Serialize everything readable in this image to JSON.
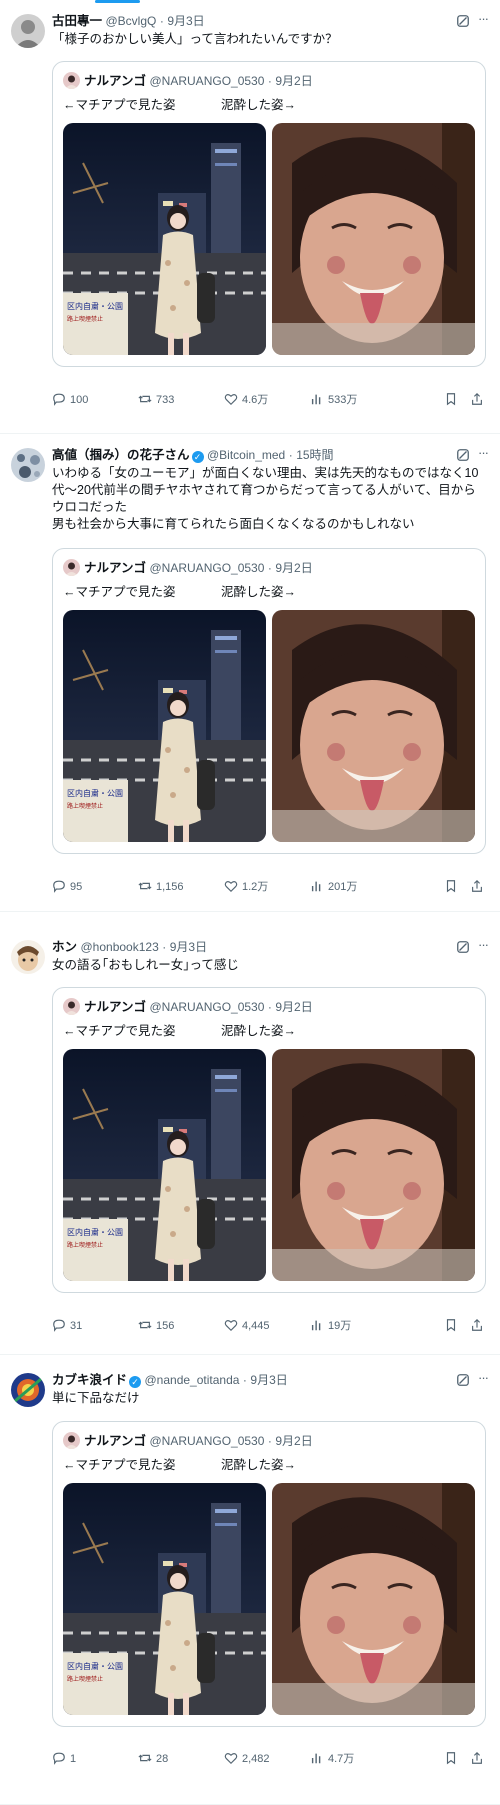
{
  "posts": [
    {
      "author": "古田專一",
      "handle": "@BcvlgQ",
      "separator": "·",
      "time": "9月3日",
      "text": [
        "「様子のおかしい美人」って言われたいんですか？"
      ],
      "quote": {
        "author": "ナルアンゴ",
        "handle": "@NARUANGO_0530",
        "time": "9月2日",
        "left_caption": "←マチアプで見た姿",
        "right_caption": "泥酔した姿→"
      },
      "stats": {
        "replies": "100",
        "reposts": "733",
        "likes": "4.6万",
        "views": "533万"
      }
    },
    {
      "author": "高値（掴み）の花子さん",
      "handle": "@Bitcoin_med",
      "separator": "·",
      "time": "15時間",
      "text": [
        "いわゆる「女のユーモア」が面白くない理由、実は先天的なものではなく10",
        "代～20代前半の間チヤホヤされて育つからだって言ってる人がいて、目から",
        "ウロコだった",
        "男も社会から大事に育てられたら面白くなくなるのかもしれない"
      ],
      "quote": {
        "author": "ナルアンゴ",
        "handle": "@NARUANGO_0530",
        "time": "9月2日",
        "left_caption": "←マチアプで見た姿",
        "right_caption": "泥酔した姿→"
      },
      "stats": {
        "replies": "95",
        "reposts": "1,156",
        "likes": "1.2万",
        "views": "201万"
      }
    },
    {
      "author": "ホン",
      "handle": "@honbook123",
      "separator": "·",
      "time": "9月3日",
      "text": [
        "女の語る｢おもしれー女｣って感じ"
      ],
      "quote": {
        "author": "ナルアンゴ",
        "handle": "@NARUANGO_0530",
        "time": "9月2日",
        "left_caption": "←マチアプで見た姿",
        "right_caption": "泥酔した姿→"
      },
      "stats": {
        "replies": "31",
        "reposts": "156",
        "likes": "4,445",
        "views": "19万"
      }
    },
    {
      "author": "カブキ浪イド",
      "handle": "@nande_otitanda",
      "separator": "·",
      "time": "9月3日",
      "text": [
        "単に下品なだけ"
      ],
      "quote": {
        "author": "ナルアンゴ",
        "handle": "@NARUANGO_0530",
        "time": "9月2日",
        "left_caption": "←マチアプで見た姿",
        "right_caption": "泥酔した姿→"
      },
      "stats": {
        "replies": "1",
        "reposts": "28",
        "likes": "2,482",
        "views": "4.7万"
      }
    }
  ],
  "icons": {
    "reply": "speech-bubble-icon",
    "repost": "repost-arrows-icon",
    "like": "heart-icon",
    "views": "bar-chart-icon",
    "bookmark": "bookmark-icon",
    "share": "share-icon",
    "grok": "grok-icon",
    "more": "ellipsis-icon",
    "verified": "verified-badge-icon"
  },
  "colors": {
    "accent": "#1d9bf0",
    "text": "#0f1419",
    "muted": "#536471",
    "border": "#cfd9de"
  }
}
